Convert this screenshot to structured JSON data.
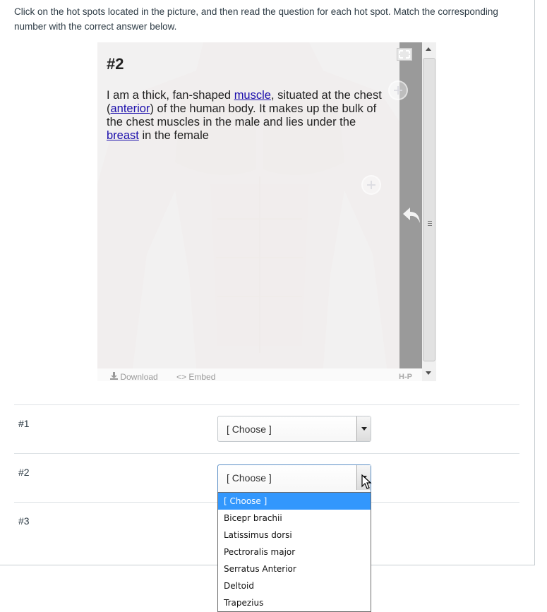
{
  "instructions": "Click on the hot spots located in the picture, and then read the question for each hot spot. Match the corresponding number with the correct answer below.",
  "popup": {
    "title": "#2",
    "text_parts": {
      "p1": "I am a thick, fan-shaped ",
      "link1": "muscle",
      "p2": ", situated at the chest (",
      "link2": "anterior",
      "p3": ") of the human body. It makes up the bulk of the chest muscles in the male and lies under the ",
      "link3": "breast",
      "p4": " in the female"
    }
  },
  "h5p_footer": {
    "download": "Download",
    "embed": "Embed",
    "logo": "H-P"
  },
  "questions": [
    {
      "label": "#1",
      "selected": "[ Choose ]"
    },
    {
      "label": "#2",
      "selected": "[ Choose ]"
    },
    {
      "label": "#3"
    }
  ],
  "dropdown_options": [
    "[ Choose ]",
    "Bicepr brachii",
    "Latissimus dorsi",
    "Pectroralis major",
    "Serratus Anterior",
    "Deltoid",
    "Trapezius"
  ],
  "colors": {
    "option_highlight": "#3297fd",
    "link": "#1a0dab",
    "popup_bar": "#9a9a9a"
  }
}
